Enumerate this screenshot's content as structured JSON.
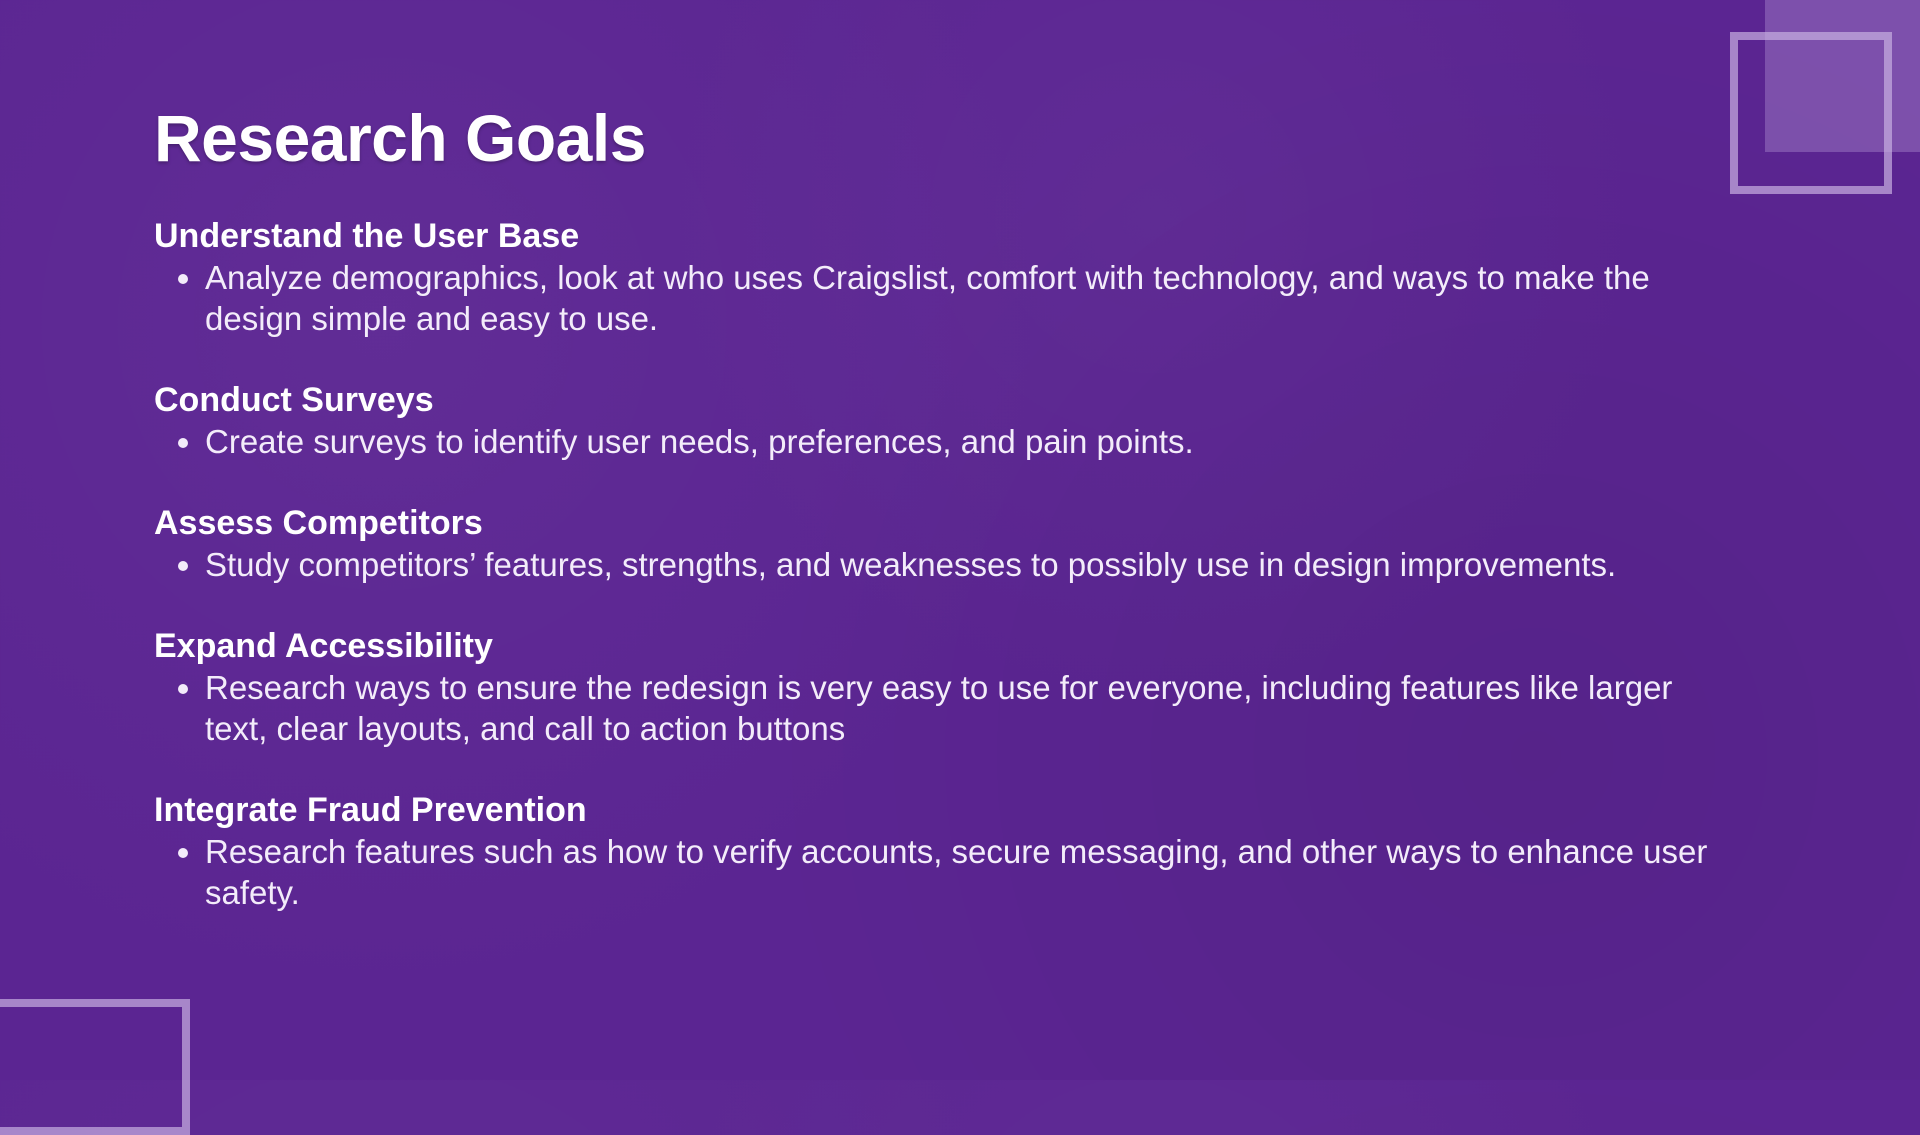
{
  "slide": {
    "title": "Research Goals",
    "sections": [
      {
        "heading": "Understand the User Base",
        "bullet": "Analyze demographics, look at who uses Craigslist, comfort with technology, and ways to make the design simple and easy to use."
      },
      {
        "heading": "Conduct Surveys",
        "bullet": "Create surveys to identify user needs, preferences, and pain points."
      },
      {
        "heading": "Assess Competitors",
        "bullet": "Study competitors’ features, strengths, and weaknesses to possibly use in design improvements."
      },
      {
        "heading": "Expand Accessibility",
        "bullet": "Research ways to ensure the redesign is very easy to use for everyone, including features like larger text, clear layouts, and call to action buttons"
      },
      {
        "heading": "Integrate Fraud Prevention",
        "bullet": "Research features such as how to verify accounts, secure messaging, and other ways to enhance user safety."
      }
    ]
  },
  "colors": {
    "background": "#5b2592",
    "text": "#ffffff",
    "decoration": "#c8afe1"
  }
}
